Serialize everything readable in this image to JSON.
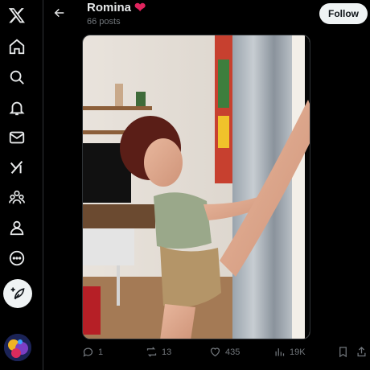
{
  "sidebar": {
    "items": [
      {
        "icon": "x-logo-icon"
      },
      {
        "icon": "home-icon"
      },
      {
        "icon": "search-icon"
      },
      {
        "icon": "bell-icon"
      },
      {
        "icon": "mail-icon"
      },
      {
        "icon": "grok-icon"
      },
      {
        "icon": "communities-icon"
      },
      {
        "icon": "profile-icon"
      },
      {
        "icon": "more-icon"
      }
    ],
    "compose_icon": "feather-plus-icon"
  },
  "header": {
    "name": "Romina",
    "heart": "❤",
    "posts": "66 posts",
    "follow_label": "Follow"
  },
  "actions": {
    "replies": "1",
    "reposts": "13",
    "likes": "435",
    "views": "19K"
  },
  "colors": {
    "background": "#000000",
    "text": "#e7e9ea",
    "muted": "#71767b",
    "heart": "#e0245e",
    "follow_bg": "#eff3f4"
  }
}
